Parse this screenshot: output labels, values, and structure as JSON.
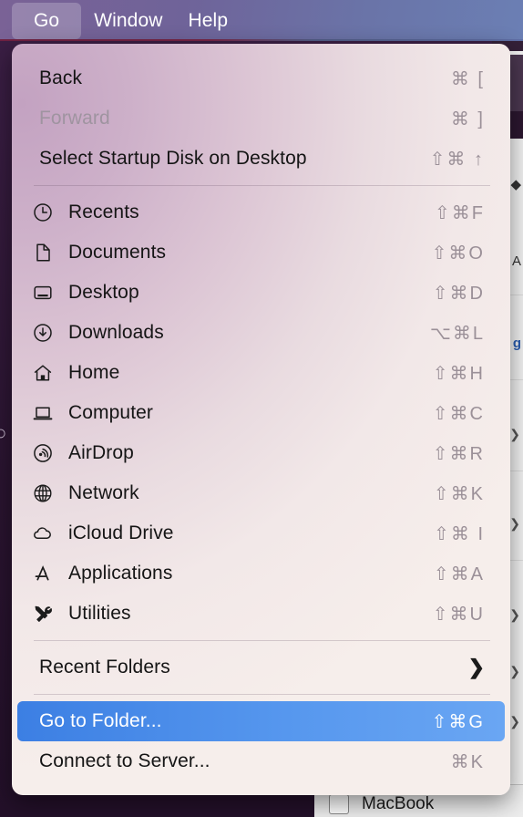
{
  "menubar": {
    "items": [
      {
        "label": "Go",
        "active": true
      },
      {
        "label": "Window",
        "active": false
      },
      {
        "label": "Help",
        "active": false
      }
    ]
  },
  "go_menu": {
    "groups": [
      {
        "items": [
          {
            "label": "Back",
            "shortcut": "⌘ [",
            "icon": null,
            "state": "enabled"
          },
          {
            "label": "Forward",
            "shortcut": "⌘ ]",
            "icon": null,
            "state": "disabled"
          },
          {
            "label": "Select Startup Disk on Desktop",
            "shortcut": "⇧⌘ ↑",
            "icon": null,
            "state": "enabled"
          }
        ]
      },
      {
        "items": [
          {
            "label": "Recents",
            "shortcut": "⇧⌘F",
            "icon": "clock-icon",
            "state": "enabled"
          },
          {
            "label": "Documents",
            "shortcut": "⇧⌘O",
            "icon": "document-icon",
            "state": "enabled"
          },
          {
            "label": "Desktop",
            "shortcut": "⇧⌘D",
            "icon": "desktop-icon",
            "state": "enabled"
          },
          {
            "label": "Downloads",
            "shortcut": "⌥⌘L",
            "icon": "download-icon",
            "state": "enabled"
          },
          {
            "label": "Home",
            "shortcut": "⇧⌘H",
            "icon": "home-icon",
            "state": "enabled"
          },
          {
            "label": "Computer",
            "shortcut": "⇧⌘C",
            "icon": "computer-icon",
            "state": "enabled"
          },
          {
            "label": "AirDrop",
            "shortcut": "⇧⌘R",
            "icon": "airdrop-icon",
            "state": "enabled"
          },
          {
            "label": "Network",
            "shortcut": "⇧⌘K",
            "icon": "network-globe-icon",
            "state": "enabled"
          },
          {
            "label": "iCloud Drive",
            "shortcut": "⇧⌘ I",
            "icon": "cloud-icon",
            "state": "enabled"
          },
          {
            "label": "Applications",
            "shortcut": "⇧⌘A",
            "icon": "applications-icon",
            "state": "enabled"
          },
          {
            "label": "Utilities",
            "shortcut": "⇧⌘U",
            "icon": "utilities-icon",
            "state": "enabled"
          }
        ]
      },
      {
        "items": [
          {
            "label": "Recent Folders",
            "shortcut": null,
            "icon": null,
            "state": "enabled",
            "submenu": true
          }
        ]
      },
      {
        "items": [
          {
            "label": "Go to Folder...",
            "shortcut": "⇧⌘G",
            "icon": null,
            "state": "selected"
          },
          {
            "label": "Connect to Server...",
            "shortcut": "⌘K",
            "icon": null,
            "state": "enabled"
          }
        ]
      }
    ]
  },
  "background": {
    "bottom_row_label": "MacBook",
    "side_glyphs": [
      "◆",
      "A",
      "g"
    ]
  },
  "colors": {
    "menubar_start": "#7a6296",
    "menubar_end": "#6b7fb4",
    "menu_panel_top_left": "#c3a2c1",
    "menu_panel_bottom_right": "#f6eeeb",
    "selection_start": "#3c7fe3",
    "selection_end": "#6aa6f3",
    "desktop": "#2a1430",
    "label_text": "#151515",
    "disabled_text": "#9f94a0",
    "shortcut_text": "#9b9098"
  }
}
